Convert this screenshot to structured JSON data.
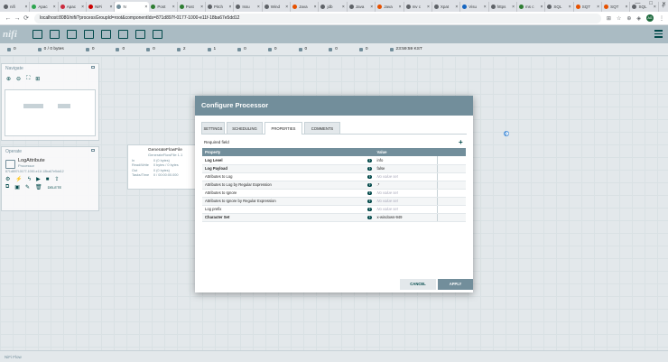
{
  "browser": {
    "tabs": [
      {
        "label": "nifi",
        "color": "#5f6368"
      },
      {
        "label": "Apac",
        "color": "#2da44e"
      },
      {
        "label": "Apac",
        "color": "#cb2b3e"
      },
      {
        "label": "NiFi",
        "color": "#cc0000"
      },
      {
        "label": "N",
        "color": "#728e9b",
        "active": true
      },
      {
        "label": "Post",
        "color": "#2e7d32"
      },
      {
        "label": "Post",
        "color": "#2e7d32"
      },
      {
        "label": "Pitch",
        "color": "#5f6368"
      },
      {
        "label": "Issu",
        "color": "#5f6368"
      },
      {
        "label": "Wind",
        "color": "#5f6368"
      },
      {
        "label": "Java",
        "color": "#e65100"
      },
      {
        "label": "jdb",
        "color": "#5f6368"
      },
      {
        "label": "Java",
        "color": "#5f6368"
      },
      {
        "label": "Java",
        "color": "#e65100"
      },
      {
        "label": "mv c",
        "color": "#5f6368"
      },
      {
        "label": "Xpat",
        "color": "#5f6368"
      },
      {
        "label": "Visu",
        "color": "#1565c0"
      },
      {
        "label": "https",
        "color": "#5f6368"
      },
      {
        "label": "ms c",
        "color": "#2e7d32"
      },
      {
        "label": "SQL",
        "color": "#5f6368"
      },
      {
        "label": "SQT",
        "color": "#e65100"
      },
      {
        "label": "SQT",
        "color": "#e65100"
      },
      {
        "label": "SQL",
        "color": "#5f6368"
      }
    ],
    "new_tab": "+",
    "controls": [
      "—",
      "□",
      "✕"
    ],
    "url": "localhost:8080/nifi/?processGroupId=root&componentIds=871d897f-0177-1000-e11f-18ba67e5dd12",
    "avatar": "AG"
  },
  "status": {
    "items": [
      "0",
      "0 / 0 bytes",
      "0",
      "0",
      "0",
      "2",
      "1",
      "0",
      "0",
      "0",
      "0",
      "0",
      "23:59:59 KST"
    ]
  },
  "navigate": {
    "title": "Navigate"
  },
  "operate": {
    "title": "Operate",
    "component_name": "LogAttribute",
    "component_type": "Processor",
    "component_id": "871d897f-0177-1000-e11f-18ba67e5dd12",
    "delete_label": "DELETE"
  },
  "processor": {
    "name": "GenerateFlowFile",
    "fragment": "GenerateFlowFile 1.1",
    "rows": [
      {
        "label": "In",
        "value": "0 (0 bytes)"
      },
      {
        "label": "Read/Write",
        "value": "0 bytes / 0 bytes"
      },
      {
        "label": "Out",
        "value": "0 (0 bytes)"
      },
      {
        "label": "Tasks/Time",
        "value": "0 / 00:00:00.000"
      }
    ]
  },
  "modal": {
    "title": "Configure Processor",
    "tabs": [
      "SETTINGS",
      "SCHEDULING",
      "PROPERTIES",
      "COMMENTS"
    ],
    "active_tab": "PROPERTIES",
    "required_label": "Required field",
    "add_symbol": "+",
    "columns": {
      "property": "Property",
      "value": "Value"
    },
    "properties": [
      {
        "name": "Log Level",
        "value": "info",
        "required": true,
        "empty": false
      },
      {
        "name": "Log Payload",
        "value": "false",
        "required": true,
        "empty": false
      },
      {
        "name": "Attributes to Log",
        "value": "No value set",
        "required": false,
        "empty": true
      },
      {
        "name": "Attributes to Log by Regular Expression",
        "value": ".*",
        "required": false,
        "empty": false
      },
      {
        "name": "Attributes to Ignore",
        "value": "No value set",
        "required": false,
        "empty": true
      },
      {
        "name": "Attributes to Ignore by Regular Expression",
        "value": "No value set",
        "required": false,
        "empty": true
      },
      {
        "name": "Log prefix",
        "value": "No value set",
        "required": false,
        "empty": true
      },
      {
        "name": "Character Set",
        "value": "x-windows-949",
        "required": true,
        "empty": false
      }
    ],
    "help_symbol": "?",
    "cancel_label": "CANCEL",
    "apply_label": "APPLY"
  },
  "footer": {
    "text": "NiFi Flow"
  },
  "colors": {
    "accent": "#728e9b",
    "primary": "#004849",
    "header": "#aabbc3"
  }
}
